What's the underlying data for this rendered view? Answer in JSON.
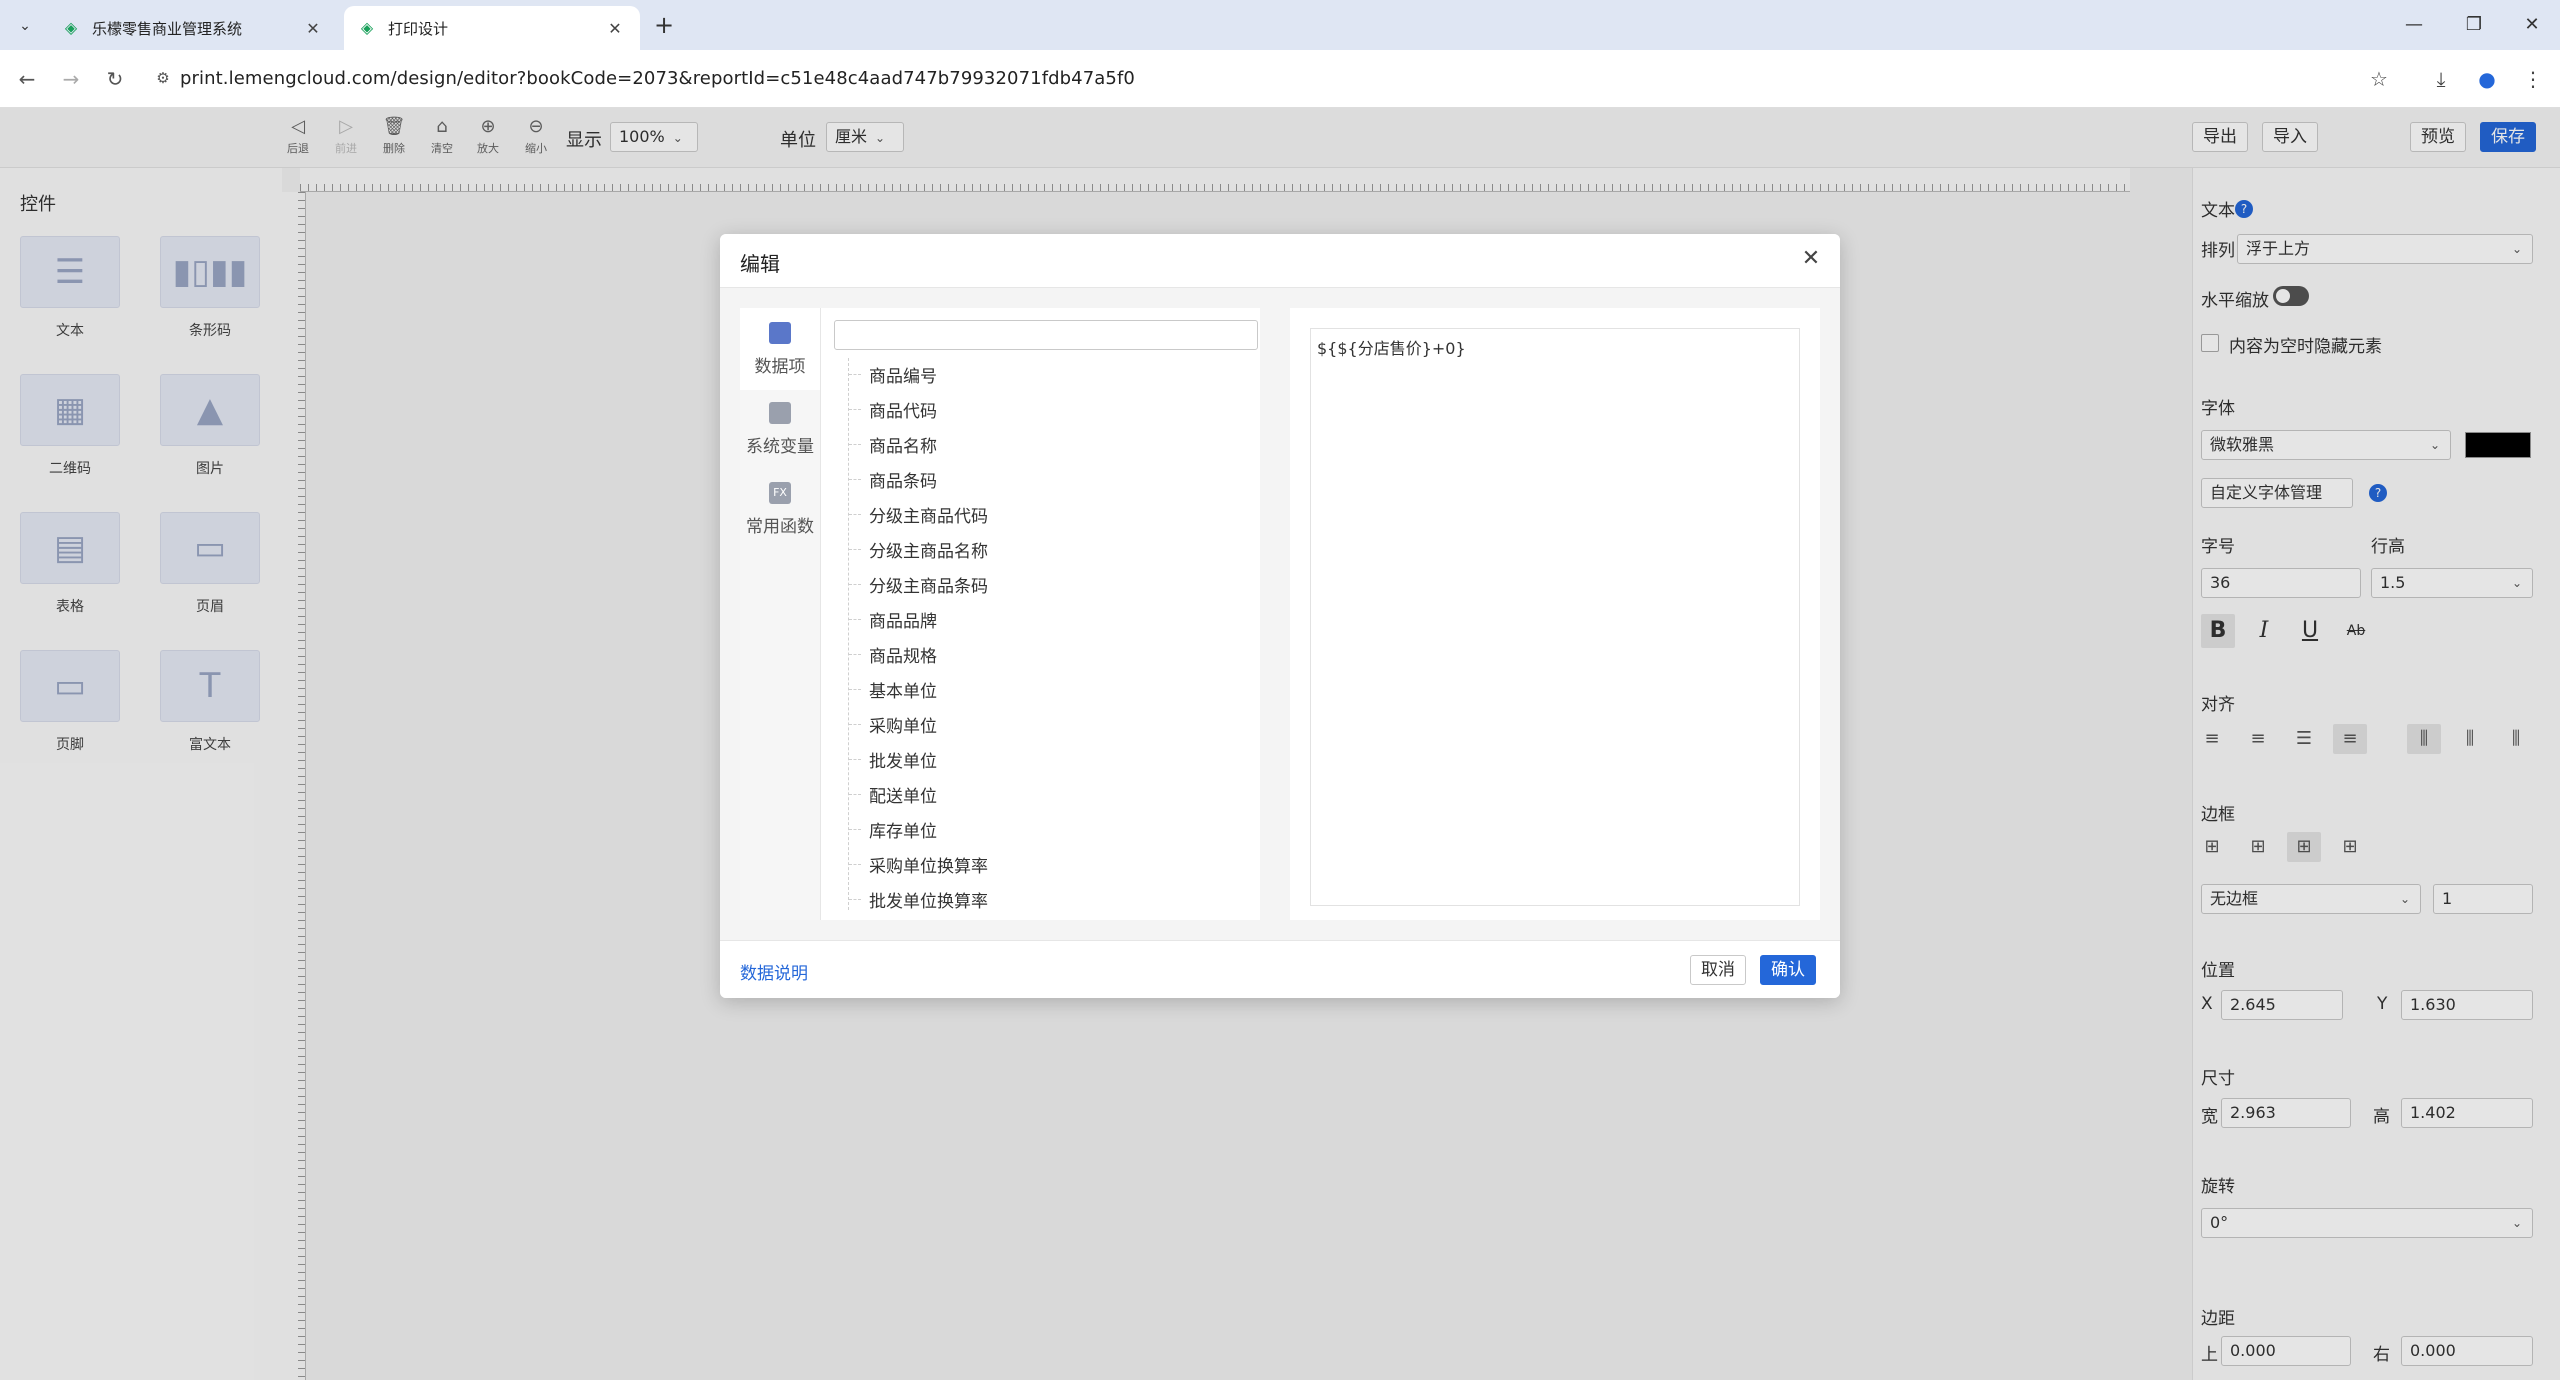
{
  "browser": {
    "tabs": [
      {
        "title": "乐檬零售商业管理系统",
        "active": false
      },
      {
        "title": "打印设计",
        "active": true
      }
    ],
    "url": "print.lemengcloud.com/design/editor?bookCode=2073&reportId=c51e48c4aad747b79932071fdb47a5f0"
  },
  "toolbar": {
    "buttons": [
      {
        "label": "后退",
        "icon": "undo-icon"
      },
      {
        "label": "前进",
        "icon": "redo-icon"
      },
      {
        "label": "删除",
        "icon": "trash-icon"
      },
      {
        "label": "清空",
        "icon": "clear-icon"
      },
      {
        "label": "放大",
        "icon": "zoom-in-icon"
      },
      {
        "label": "缩小",
        "icon": "zoom-out-icon"
      }
    ],
    "display_label": "显示",
    "display_value": "100%",
    "unit_label": "单位",
    "unit_value": "厘米",
    "export_label": "导出",
    "import_label": "导入",
    "preview_label": "预览",
    "save_label": "保存"
  },
  "left_panel": {
    "title": "控件",
    "controls": [
      {
        "label": "文本",
        "icon": "text-control-icon"
      },
      {
        "label": "条形码",
        "icon": "barcode-icon"
      },
      {
        "label": "二维码",
        "icon": "qrcode-icon"
      },
      {
        "label": "图片",
        "icon": "image-icon"
      },
      {
        "label": "表格",
        "icon": "table-icon"
      },
      {
        "label": "页眉",
        "icon": "header-icon"
      },
      {
        "label": "页脚",
        "icon": "footer-icon"
      },
      {
        "label": "富文本",
        "icon": "richtext-icon"
      }
    ]
  },
  "right_panel": {
    "section_text": "文本",
    "arrange_label": "排列",
    "arrange_value": "浮于上方",
    "hscale_label": "水平缩放",
    "hide_empty_label": "内容为空时隐藏元素",
    "font_label": "字体",
    "font_value": "微软雅黑",
    "font_color": "#000000",
    "custom_font_label": "自定义字体管理",
    "size_label": "字号",
    "size_value": "36",
    "lineheight_label": "行高",
    "lineheight_value": "1.5",
    "align_label": "对齐",
    "border_label": "边框",
    "border_value": "无边框",
    "border_width": "1",
    "position_label": "位置",
    "pos_x_label": "X",
    "pos_x": "2.645",
    "pos_y_label": "Y",
    "pos_y": "1.630",
    "dim_label": "尺寸",
    "width_label": "宽",
    "width_value": "2.963",
    "height_label": "高",
    "height_value": "1.402",
    "rotate_label": "旋转",
    "rotate_value": "0°",
    "margin_label": "边距",
    "margin_top_label": "上",
    "margin_top": "0.000",
    "margin_right_label": "右",
    "margin_right": "0.000"
  },
  "modal": {
    "title": "编辑",
    "side_tabs": [
      {
        "label": "数据项",
        "active": true
      },
      {
        "label": "系统变量",
        "active": false
      },
      {
        "label": "常用函数",
        "active": false
      }
    ],
    "side_tab_icons": [
      "",
      "",
      "FX"
    ],
    "search_placeholder": "",
    "items": [
      "商品编号",
      "商品代码",
      "商品名称",
      "商品条码",
      "分级主商品代码",
      "分级主商品名称",
      "分级主商品条码",
      "商品品牌",
      "商品规格",
      "基本单位",
      "采购单位",
      "批发单位",
      "配送单位",
      "库存单位",
      "采购单位换算率",
      "批发单位换算率"
    ],
    "expression": "${${分店售价}+0}",
    "help_link": "数据说明",
    "cancel_label": "取消",
    "confirm_label": "确认"
  }
}
